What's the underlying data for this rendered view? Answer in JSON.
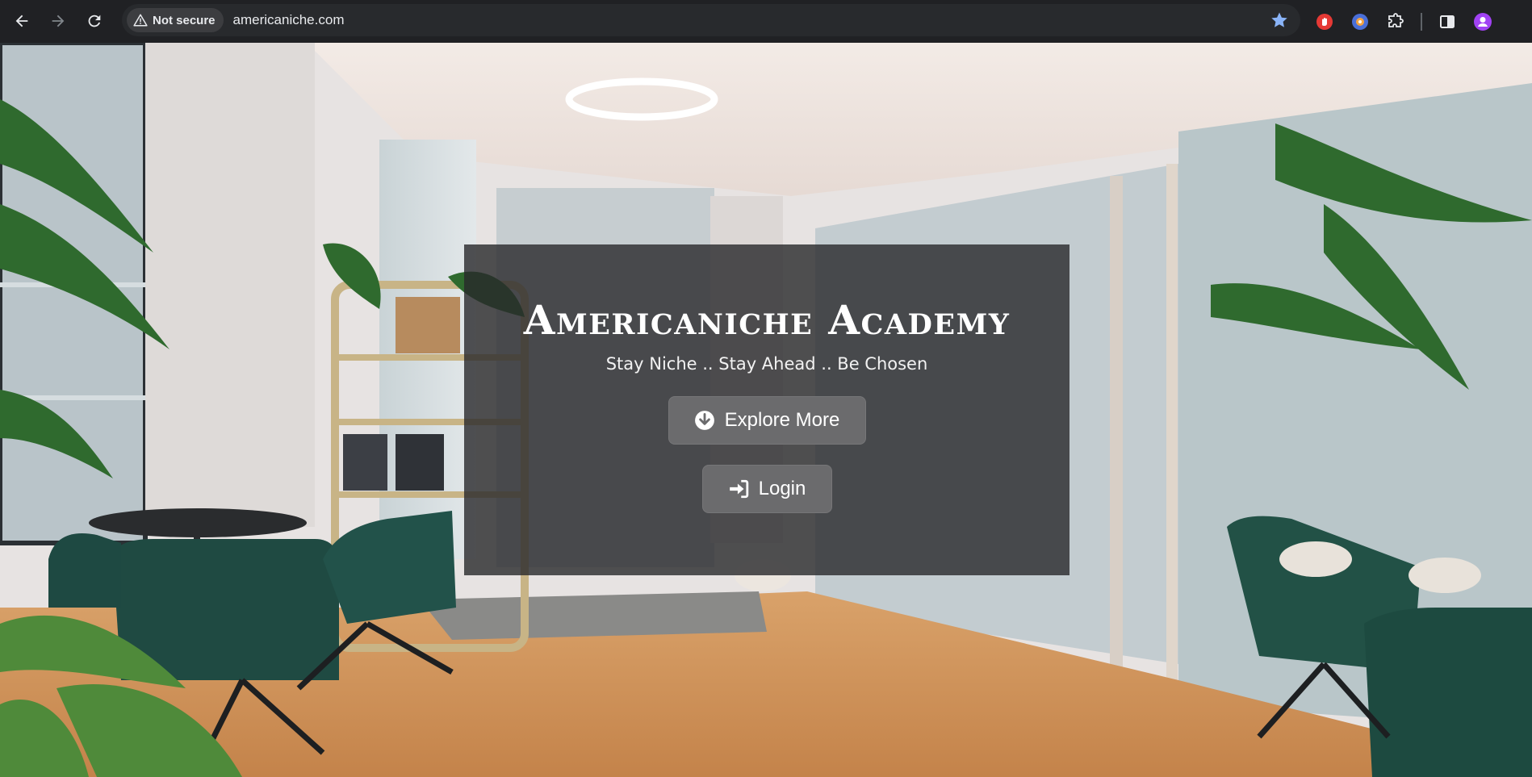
{
  "browser": {
    "security_label": "Not secure",
    "url": "americaniche.com",
    "icons": {
      "back": "arrow-left-icon",
      "forward": "arrow-right-icon",
      "reload": "reload-icon",
      "warning": "warning-triangle-icon",
      "bookmark": "star-icon",
      "extensions": [
        "hand-stop-icon",
        "shield-eye-icon",
        "puzzle-icon"
      ],
      "side_panel": "side-panel-icon",
      "profile": "avatar-icon"
    },
    "colors": {
      "chrome_bg": "#202124",
      "omnibox_bg": "#282a2d",
      "star": "#8ab4f8"
    }
  },
  "hero": {
    "title": "Americaniche Academy",
    "tagline": "Stay Niche .. Stay Ahead .. Be Chosen",
    "explore_label": "Explore More",
    "login_label": "Login",
    "icons": {
      "explore": "arrow-down-circle-icon",
      "login": "sign-in-icon"
    },
    "colors": {
      "card_bg": "#28282a",
      "button_bg": "#6b6b6d",
      "text": "#ffffff"
    }
  }
}
